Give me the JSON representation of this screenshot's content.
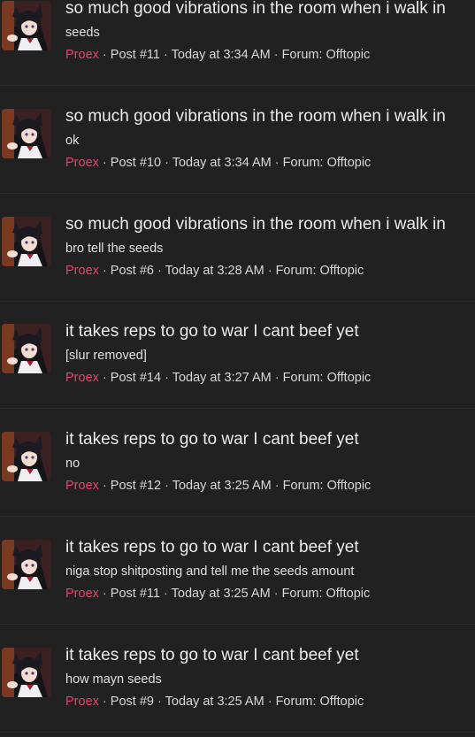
{
  "results": [
    {
      "title": "so much good vibrations in the room when i walk in",
      "snippet": "seeds",
      "author": "Proex",
      "post": "Post #11",
      "time": "Today at 3:34 AM",
      "forum": "Forum: Offtopic"
    },
    {
      "title": "so much good vibrations in the room when i walk in",
      "snippet": "ok",
      "author": "Proex",
      "post": "Post #10",
      "time": "Today at 3:34 AM",
      "forum": "Forum: Offtopic"
    },
    {
      "title": "so much good vibrations in the room when i walk in",
      "snippet": "bro tell the seeds",
      "author": "Proex",
      "post": "Post #6",
      "time": "Today at 3:28 AM",
      "forum": "Forum: Offtopic"
    },
    {
      "title": "it takes reps to go to war I cant beef yet",
      "snippet": "[slur removed]",
      "author": "Proex",
      "post": "Post #14",
      "time": "Today at 3:27 AM",
      "forum": "Forum: Offtopic"
    },
    {
      "title": "it takes reps to go to war I cant beef yet",
      "snippet": "no",
      "author": "Proex",
      "post": "Post #12",
      "time": "Today at 3:25 AM",
      "forum": "Forum: Offtopic"
    },
    {
      "title": "it takes reps to go to war I cant beef yet",
      "snippet": "niga stop shitposting and tell me the seeds amount",
      "author": "Proex",
      "post": "Post #11",
      "time": "Today at 3:25 AM",
      "forum": "Forum: Offtopic"
    },
    {
      "title": "it takes reps to go to war I cant beef yet",
      "snippet": "how mayn seeds",
      "author": "Proex",
      "post": "Post #9",
      "time": "Today at 3:25 AM",
      "forum": "Forum: Offtopic"
    }
  ],
  "separator": "·",
  "colors": {
    "background": "#212122",
    "author": "#e8416c",
    "divider": "#2d2d2e"
  }
}
